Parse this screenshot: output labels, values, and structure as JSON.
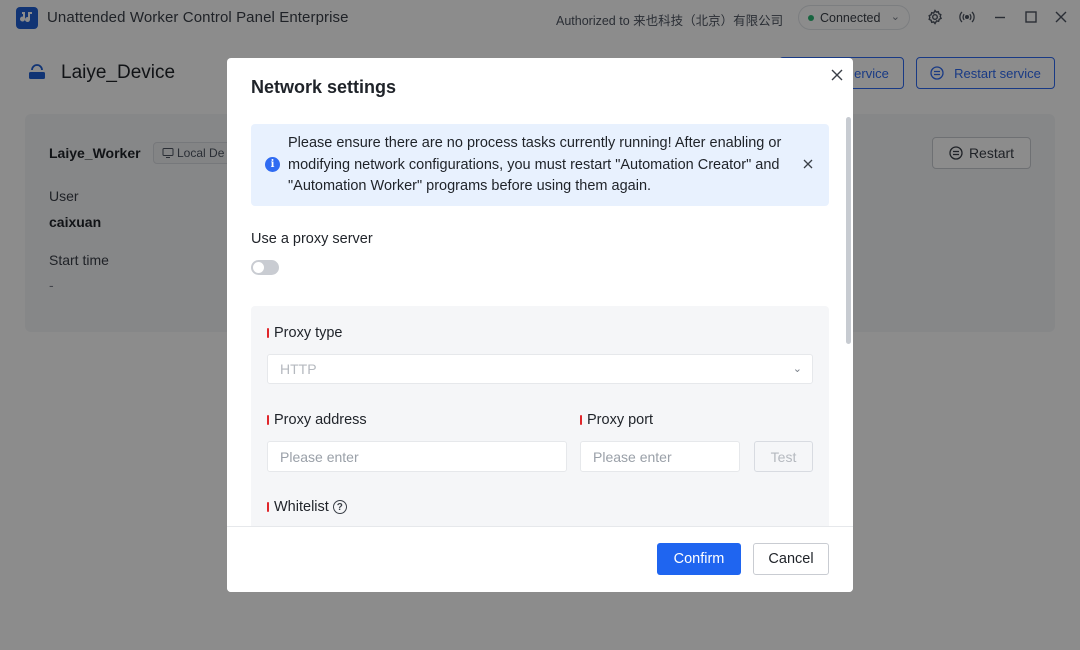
{
  "window": {
    "title": "Unattended Worker Control Panel Enterprise",
    "authorized": "Authorized to 来也科技（北京）有限公司",
    "connection_status": "Connected",
    "status_color": "#2bb673"
  },
  "header": {
    "device_title": "Laiye_Device",
    "buttons": {
      "stop_service_partial": "ervice",
      "restart_service": "Restart service"
    }
  },
  "card": {
    "worker_name": "Laiye_Worker",
    "local_tag": "Local De",
    "user_label": "User",
    "user_value": "caixuan",
    "start_time_label": "Start time",
    "start_time_value": "-",
    "restart_label": "Restart"
  },
  "modal": {
    "title": "Network settings",
    "alert_text": "Please ensure there are no process tasks currently running! After enabling or modifying network configurations, you must restart \"Automation Creator\" and \"Automation Worker\" programs before using them again.",
    "proxy_toggle_label": "Use a proxy server",
    "proxy_enabled": false,
    "proxy_type_label": "Proxy type",
    "proxy_type_value": "HTTP",
    "proxy_address_label": "Proxy address",
    "proxy_address_placeholder": "Please enter",
    "proxy_port_label": "Proxy port",
    "proxy_port_placeholder": "Please enter",
    "test_label": "Test",
    "whitelist_label": "Whitelist",
    "confirm_label": "Confirm",
    "cancel_label": "Cancel"
  },
  "colors": {
    "accent": "#1f65f0",
    "required": "#e0262b"
  }
}
